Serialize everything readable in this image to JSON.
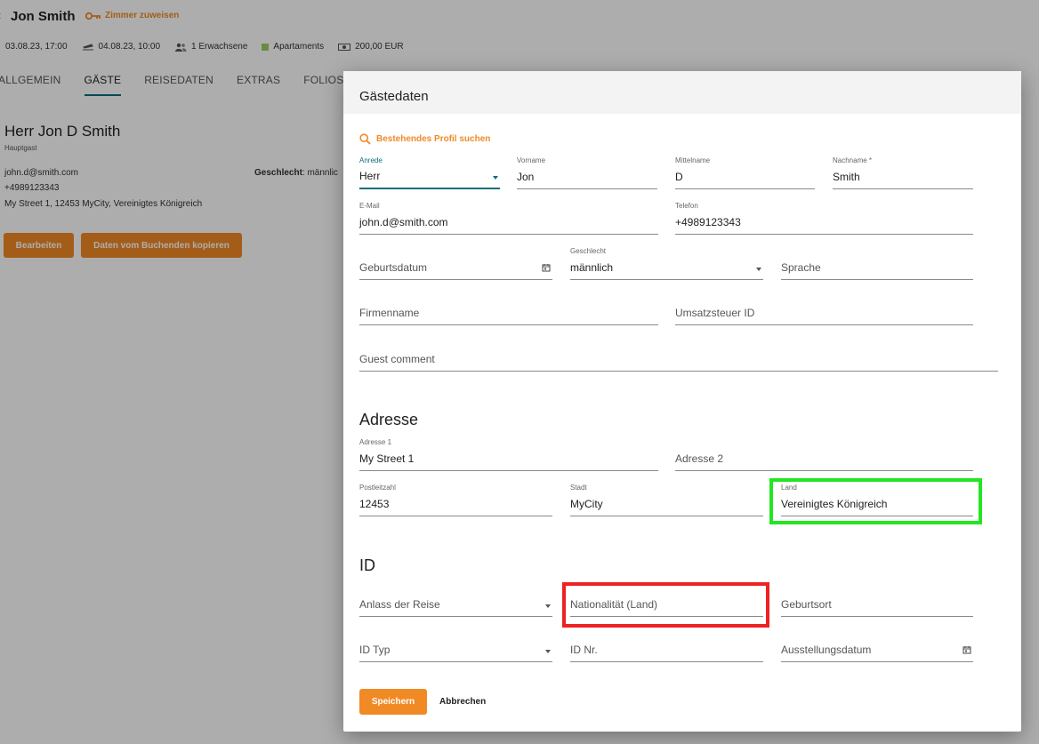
{
  "background": {
    "back_glyph": "‹",
    "guest_title": "Jon Smith",
    "assign_room": "Zimmer zuweisen",
    "arrival": "03.08.23, 17:00",
    "departure": "04.08.23, 10:00",
    "guests": "1 Erwachsene",
    "room_type": "Apartaments",
    "price": "200,00 EUR",
    "tabs": [
      "ALLGEMEIN",
      "GÄSTE",
      "REISEDATEN",
      "EXTRAS",
      "FOLIOS"
    ],
    "active_tab": "GÄSTE",
    "guest_fullname": "Herr Jon D Smith",
    "guest_role": "Hauptgast",
    "email": "john.d@smith.com",
    "phone": "+4989123343",
    "address": "My Street 1, 12453 MyCity, Vereinigtes Königreich",
    "gender_label": "Geschlecht",
    "gender_value": ": männlic",
    "edit_button": "Bearbeiten",
    "copy_button": "Daten vom Buchenden kopieren",
    "room_type_color": "#9ccc65"
  },
  "dialog": {
    "title": "Gästedaten",
    "search_profile": "Bestehendes Profil suchen",
    "fields": {
      "salutation": {
        "label": "Anrede",
        "value": "Herr"
      },
      "first_name": {
        "label": "Vorname",
        "value": "Jon"
      },
      "middle_name": {
        "label": "Mittelname",
        "value": "D"
      },
      "last_name": {
        "label": "Nachname *",
        "value": "Smith"
      },
      "email": {
        "label": "E-Mail",
        "value": "john.d@smith.com"
      },
      "phone": {
        "label": "Telefon",
        "value": "+4989123343"
      },
      "birthdate": {
        "placeholder": "Geburtsdatum"
      },
      "gender": {
        "label": "Geschlecht",
        "value": "männlich"
      },
      "language": {
        "placeholder": "Sprache"
      },
      "company": {
        "placeholder": "Firmenname"
      },
      "vat_id": {
        "placeholder": "Umsatzsteuer ID"
      },
      "comment": {
        "placeholder": "Guest comment"
      },
      "address1": {
        "label": "Adresse 1",
        "value": "My Street 1"
      },
      "address2": {
        "placeholder": "Adresse 2"
      },
      "zip": {
        "label": "Postleitzahl",
        "value": "12453"
      },
      "city": {
        "label": "Stadt",
        "value": "MyCity"
      },
      "country": {
        "label": "Land",
        "value": "Vereinigtes Königreich"
      },
      "trip_reason": {
        "placeholder": "Anlass der Reise"
      },
      "nationality": {
        "placeholder": "Nationalität (Land)"
      },
      "birthplace": {
        "placeholder": "Geburtsort"
      },
      "id_type": {
        "placeholder": "ID Typ"
      },
      "id_number": {
        "placeholder": "ID Nr."
      },
      "issue_date": {
        "placeholder": "Ausstellungsdatum"
      }
    },
    "section_address": "Adresse",
    "section_id": "ID",
    "save_button": "Speichern",
    "cancel_button": "Abbrechen"
  },
  "colors": {
    "accent": "#f08a24",
    "focus": "#0d6e7e",
    "highlight_green": "#22e622",
    "highlight_red": "#ee2222"
  }
}
